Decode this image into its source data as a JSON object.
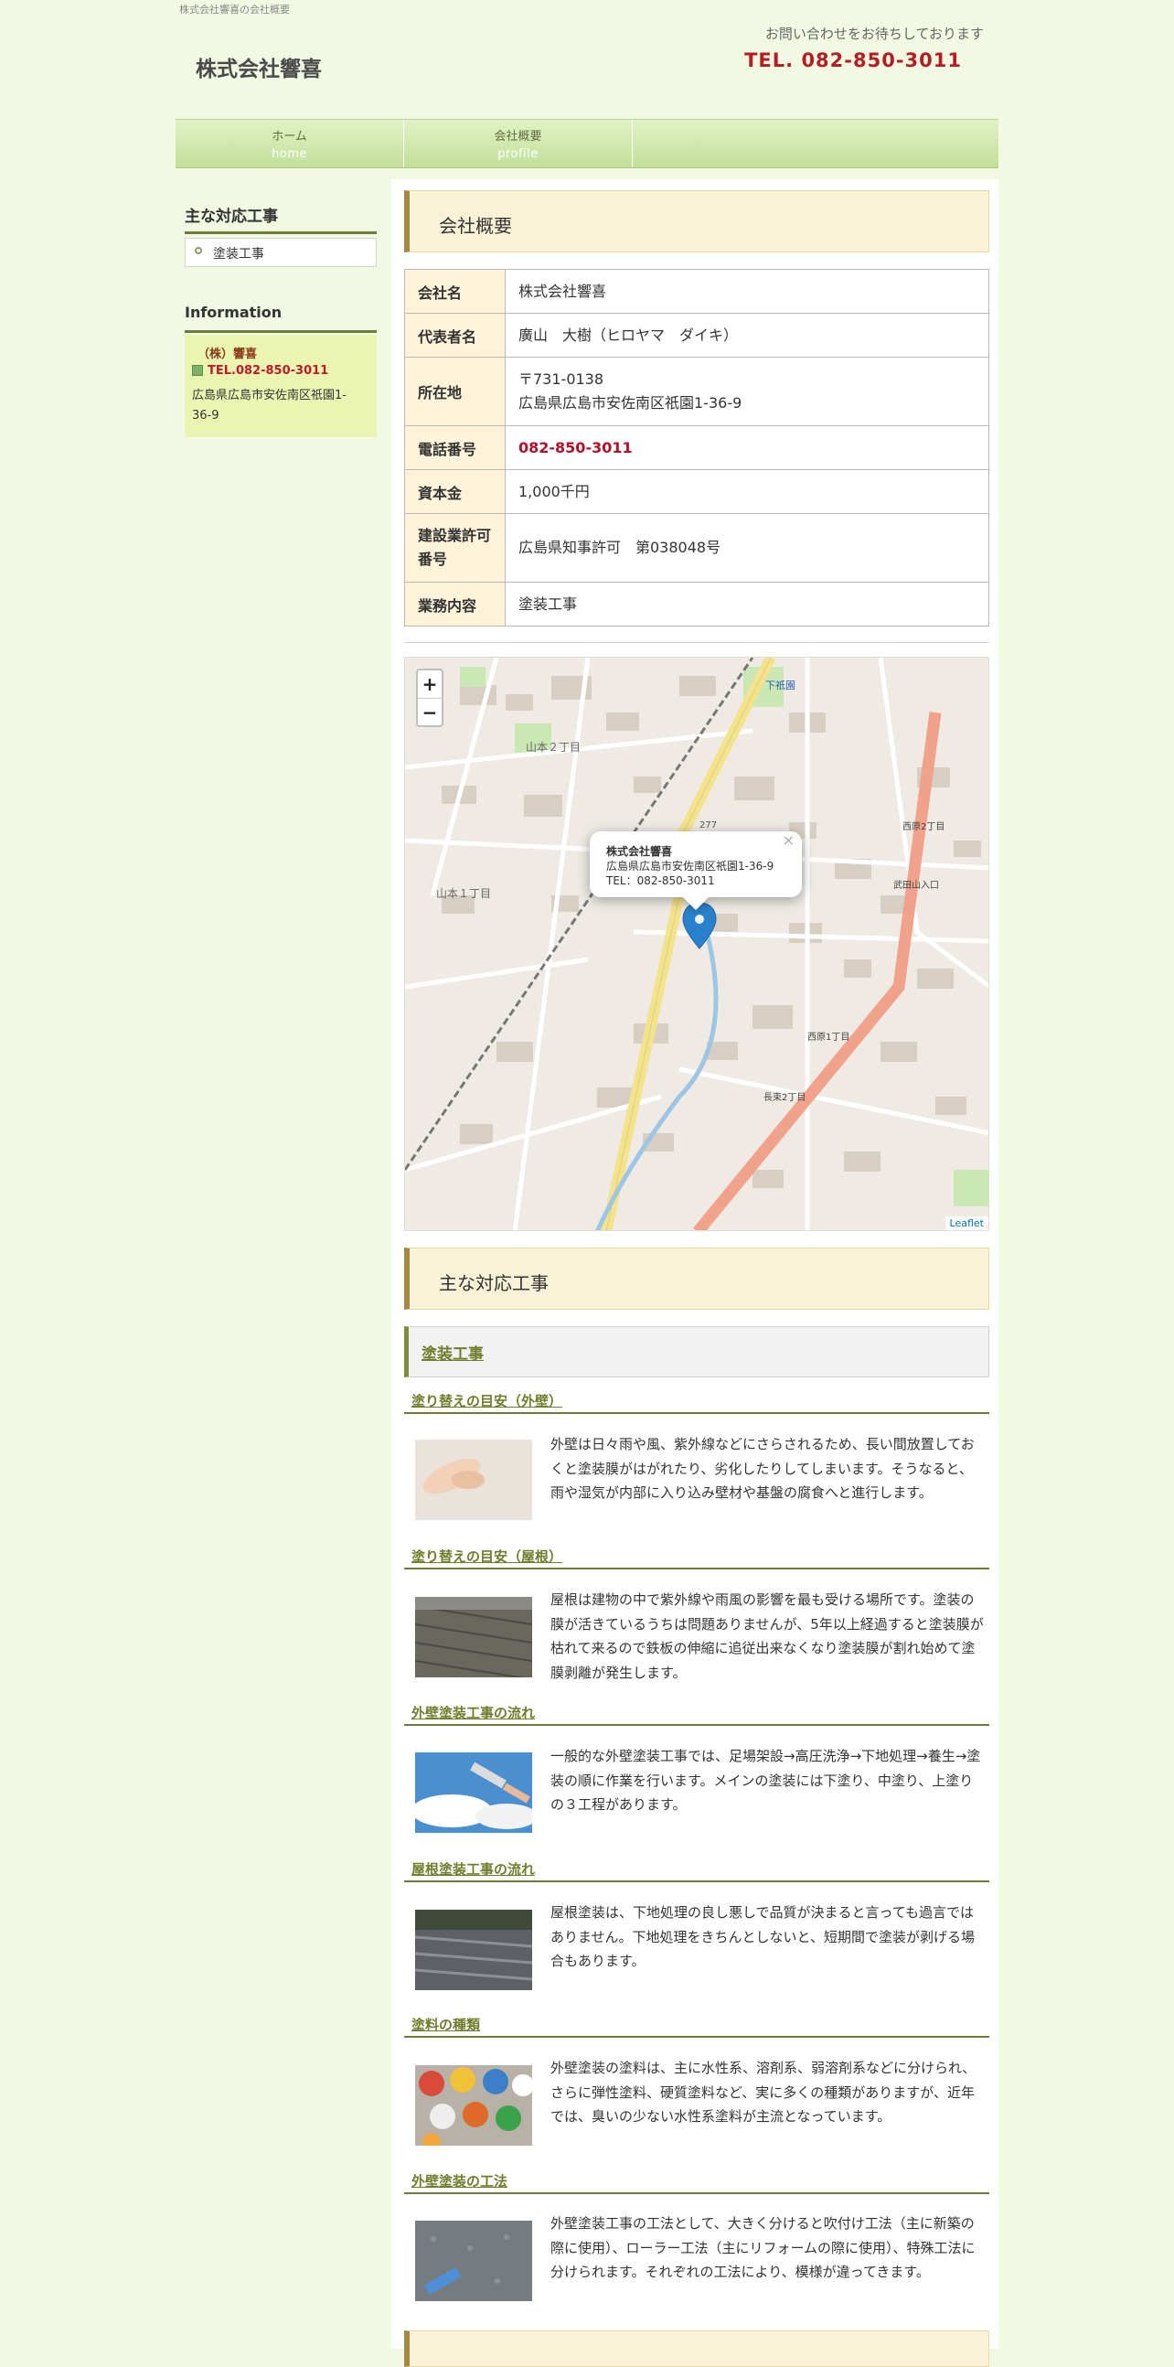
{
  "header": {
    "tagline": "株式会社響喜の会社概要",
    "site_title": "株式会社響喜",
    "contact_message": "お問い合わせをお待ちしております",
    "contact_tel": "TEL. 082-850-3011"
  },
  "nav": {
    "items": [
      {
        "jp": "ホーム",
        "en": "home"
      },
      {
        "jp": "会社概要",
        "en": "profile"
      }
    ]
  },
  "sidebar": {
    "works_title": "主な対応工事",
    "works_items": [
      "塗装工事"
    ],
    "info_title": "Information",
    "info_name": "（株）響喜",
    "info_tel": "TEL.082-850-3011",
    "info_address": "広島県広島市安佐南区祇園1-36-9"
  },
  "main": {
    "profile_heading": "会社概要",
    "profile_table": [
      {
        "label": "会社名",
        "value": "株式会社響喜"
      },
      {
        "label": "代表者名",
        "value": "廣山　大樹（ヒロヤマ　ダイキ）"
      },
      {
        "label": "所在地",
        "value": "〒731-0138",
        "value2": "広島県広島市安佐南区祇園1-36-9"
      },
      {
        "label": "電話番号",
        "value": "082-850-3011"
      },
      {
        "label": "資本金",
        "value": "1,000千円"
      },
      {
        "label": "建設業許可番号",
        "value": "広島県知事許可　第038048号"
      },
      {
        "label": "業務内容",
        "value": "塗装工事"
      }
    ],
    "map": {
      "zoom_in": "+",
      "zoom_out": "−",
      "popup_name": "株式会社響喜",
      "popup_address": "広島県広島市安佐南区祇園1-36-9",
      "popup_tel": "TEL：082-850-3011",
      "popup_close": "×",
      "attribution": "Leaflet",
      "place_labels": {
        "yamamoto2": "山本２丁目",
        "yamamoto1": "山本１丁目",
        "shimogion": "下祇園",
        "nishihara1": "西原1丁目",
        "nishihara2": "西原2丁目",
        "takeda": "武田山入口",
        "nagatsuka": "長束2丁目",
        "route": "277"
      }
    },
    "works_heading": "主な対応工事",
    "works_sub_heading": "塗装工事",
    "sections": [
      {
        "title": "塗り替えの目安（外壁）",
        "text": "外壁は日々雨や風、紫外線などにさらされるため、長い間放置しておくと塗装膜がはがれたり、劣化したりしてしまいます。そうなると、雨や湿気が内部に入り込み壁材や基盤の腐食へと進行します。"
      },
      {
        "title": "塗り替えの目安（屋根）",
        "text": "屋根は建物の中で紫外線や雨風の影響を最も受ける場所です。塗装の膜が活きているうちは問題ありませんが、5年以上経過すると塗装膜が枯れて来るので鉄板の伸縮に追従出来なくなり塗装膜が割れ始めて塗膜剥離が発生します。"
      },
      {
        "title": "外壁塗装工事の流れ",
        "text": "一般的な外壁塗装工事では、足場架設→高圧洗浄→下地処理→養生→塗装の順に作業を行います。メインの塗装には下塗り、中塗り、上塗りの３工程があります。"
      },
      {
        "title": "屋根塗装工事の流れ",
        "text": "屋根塗装は、下地処理の良し悪しで品質が決まると言っても過言ではありません。下地処理をきちんとしないと、短期間で塗装が剥げる場合もあります。"
      },
      {
        "title": "塗料の種類",
        "text": "外壁塗装の塗料は、主に水性系、溶剤系、弱溶剤系などに分けられ、さらに弾性塗料、硬質塗料など、実に多くの種類がありますが、近年では、臭いの少ない水性系塗料が主流となっています。"
      },
      {
        "title": "外壁塗装の工法",
        "text": "外壁塗装工事の工法として、大きく分けると吹付け工法（主に新築の際に使用）、ローラー工法（主にリフォームの際に使用）、特殊工法に分けられます。それぞれの工法により、模様が違ってきます。"
      }
    ]
  }
}
